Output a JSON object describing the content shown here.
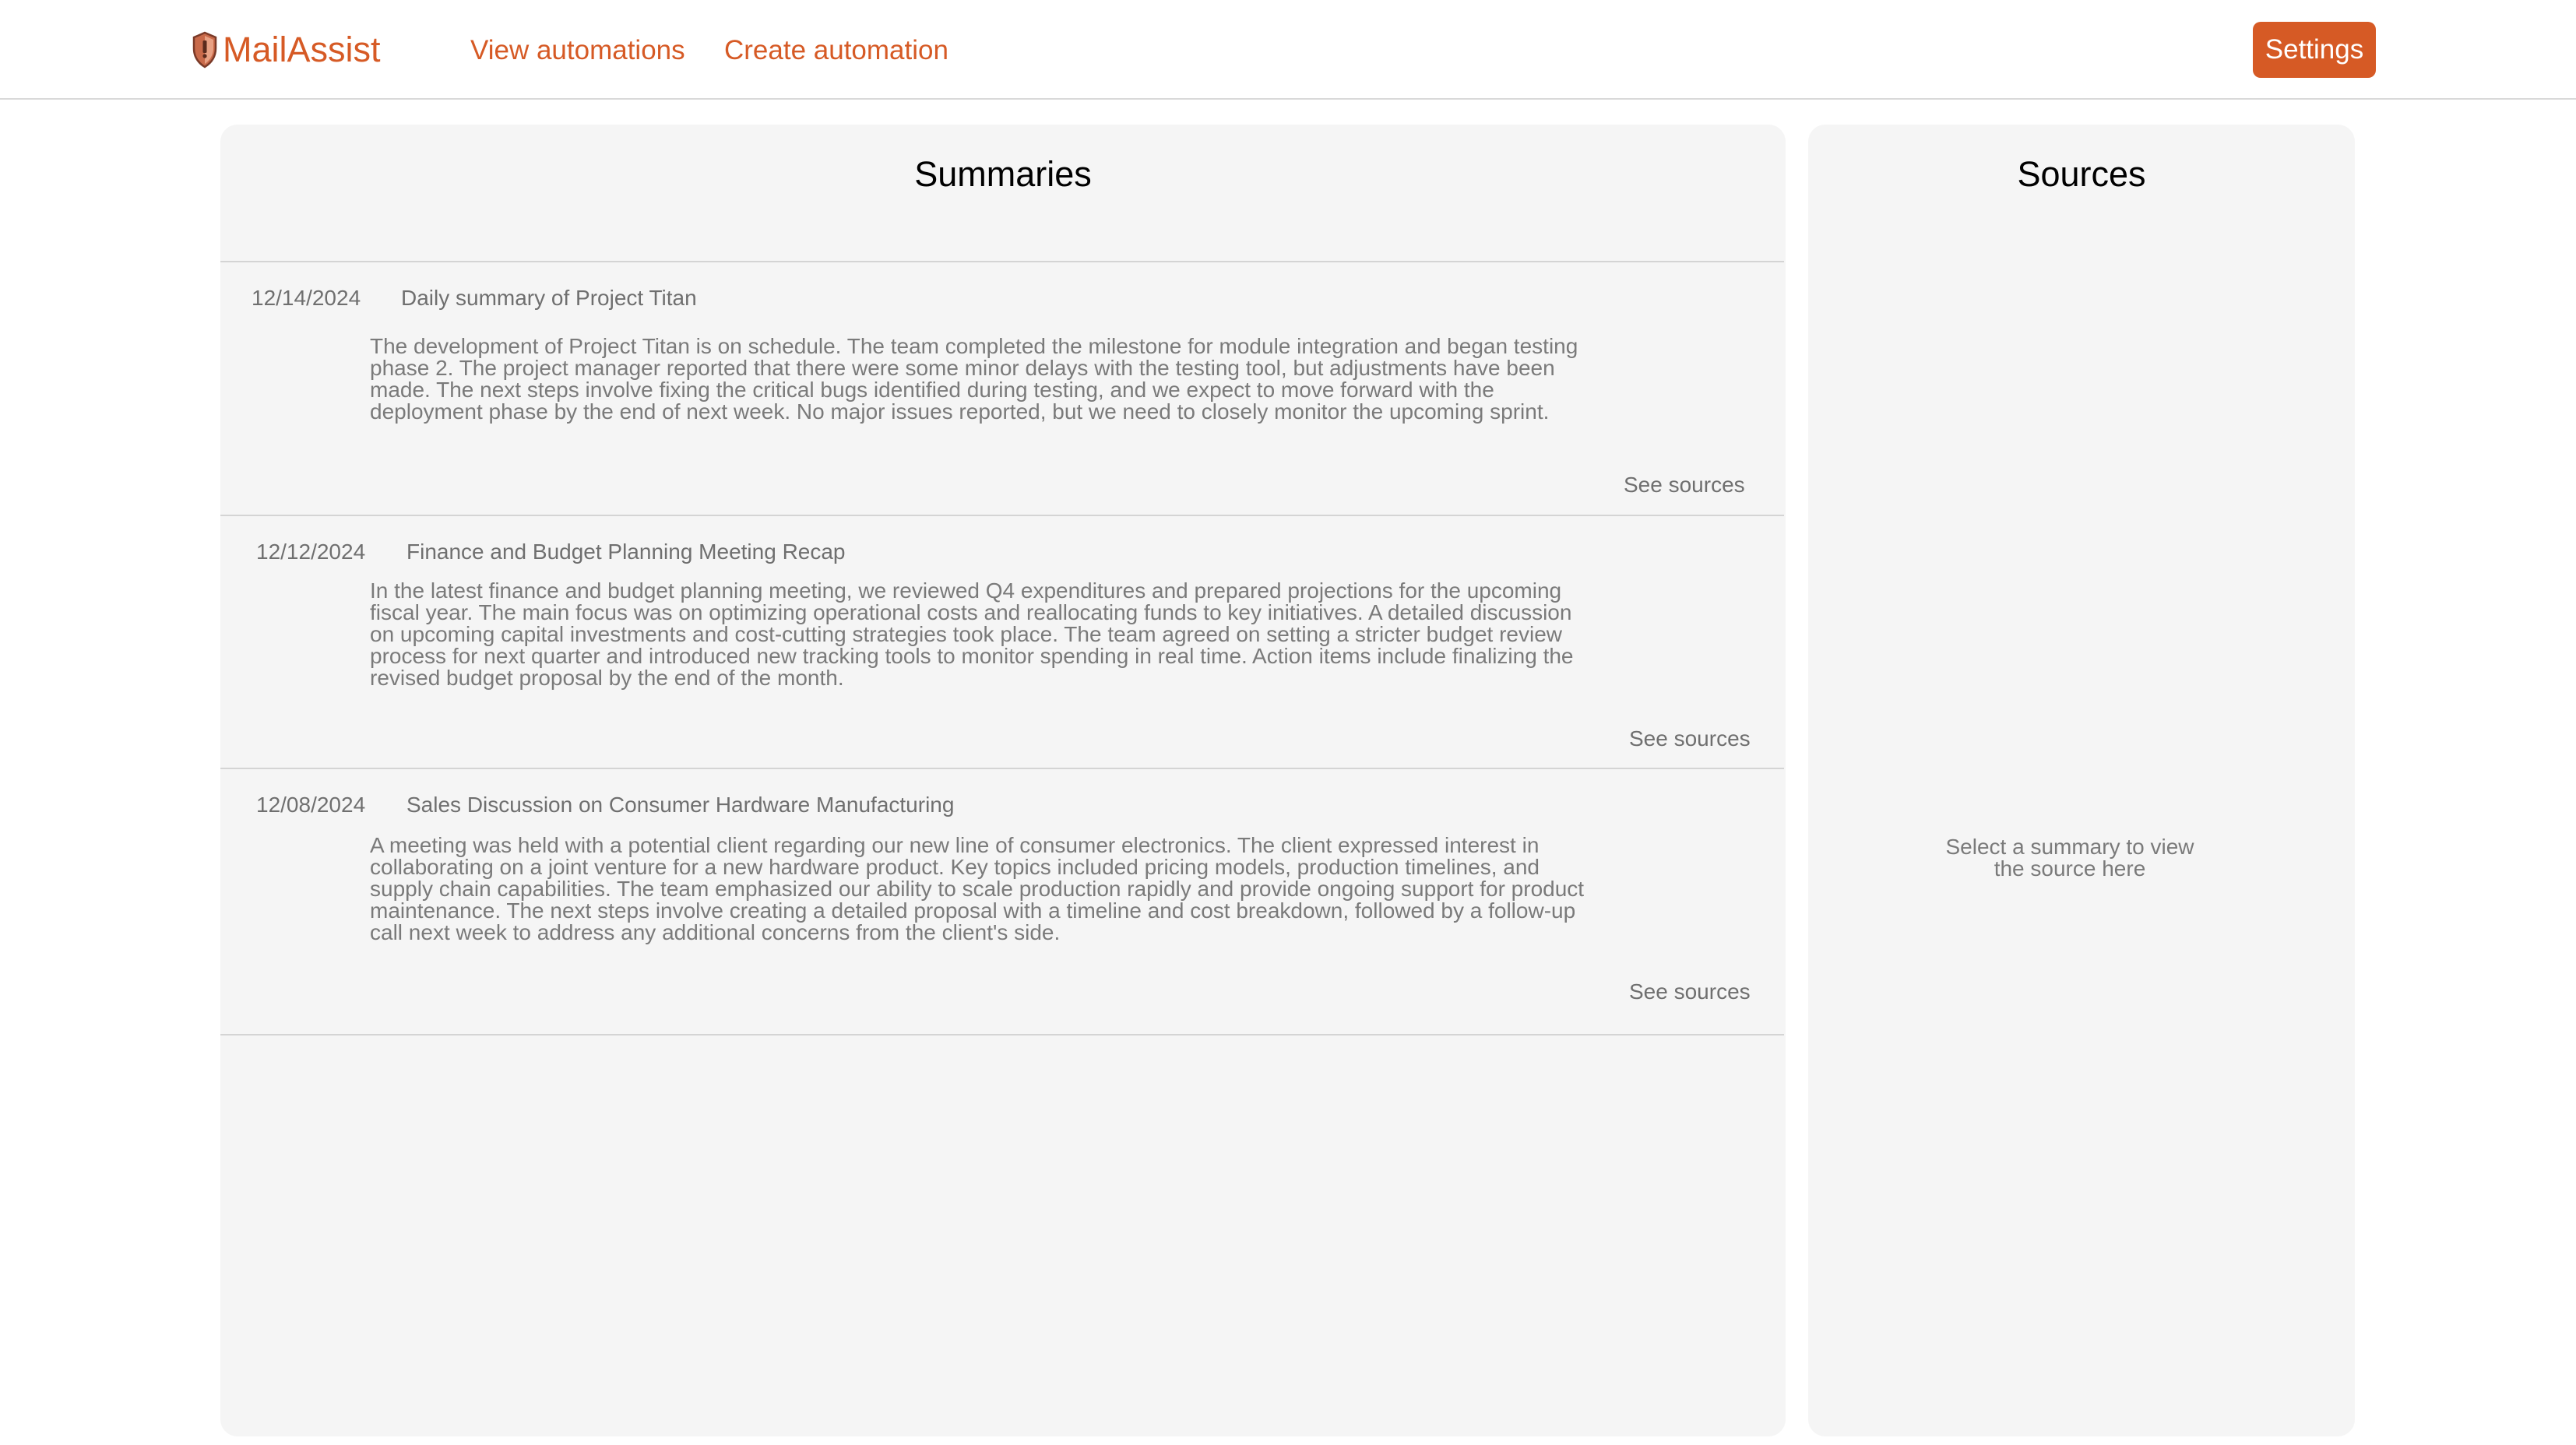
{
  "app": {
    "name": "MailAssist",
    "accent_color": "#d65a25",
    "logo_icon": "shield-icon"
  },
  "nav": {
    "links": [
      {
        "label": "View automations"
      },
      {
        "label": "Create automation"
      }
    ],
    "settings_label": "Settings"
  },
  "summaries": {
    "title": "Summaries",
    "items": [
      {
        "date": "12/14/2024",
        "title": "Daily summary of Project Titan",
        "body": "The development of Project Titan is on schedule. The team completed the milestone for module integration and began testing phase 2. The project manager reported that there were some minor delays with the testing tool, but adjustments have been made. The next steps involve fixing the critical bugs identified during testing, and we expect to move forward with the deployment phase by the end of next week. No major issues reported, but we need to closely monitor the upcoming sprint.",
        "link_label": "See sources"
      },
      {
        "date": "12/12/2024",
        "title": "Finance and Budget Planning Meeting Recap",
        "body": "In the latest finance and budget planning meeting, we reviewed Q4 expenditures and prepared projections for the upcoming fiscal year. The main focus was on optimizing operational costs and reallocating funds to key initiatives. A detailed discussion on upcoming capital investments and cost-cutting strategies took place. The team agreed on setting a stricter budget review process for next quarter and introduced new tracking tools to monitor spending in real time. Action items include finalizing the revised budget proposal by the end of the month.",
        "link_label": "See sources"
      },
      {
        "date": "12/08/2024",
        "title": "Sales Discussion on Consumer Hardware Manufacturing",
        "body": "A meeting was held with a potential client regarding our new line of consumer electronics. The client expressed interest in collaborating on a joint venture for a new hardware product. Key topics included pricing models, production timelines, and supply chain capabilities. The team emphasized our ability to scale production rapidly and provide ongoing support for product maintenance. The next steps involve creating a detailed proposal with a timeline and cost breakdown, followed by a follow-up call next week to address any additional concerns from the client's side.",
        "link_label": "See sources"
      }
    ]
  },
  "sources": {
    "title": "Sources",
    "placeholder": "Select a summary to view the source here"
  }
}
